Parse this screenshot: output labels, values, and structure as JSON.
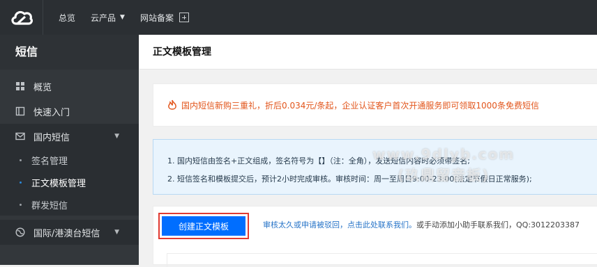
{
  "topbar": {
    "logo_icon": "cloud-logo-icon",
    "nav": [
      {
        "label": "总览"
      },
      {
        "label": "云产品"
      },
      {
        "label": "网站备案"
      }
    ]
  },
  "sidebar": {
    "title": "短信",
    "items": [
      {
        "label": "概览",
        "icon": "grid-icon"
      },
      {
        "label": "快速入门",
        "icon": "book-icon"
      },
      {
        "label": "国内短信",
        "icon": "mail-icon"
      }
    ],
    "domestic_subitems": [
      {
        "label": "签名管理"
      },
      {
        "label": "正文模板管理"
      },
      {
        "label": "群发短信"
      }
    ],
    "intl": {
      "label": "国际/港澳台短信",
      "icon": "globe-icon"
    }
  },
  "main": {
    "title": "正文模板管理",
    "promo": "国内短信新购三重礼，折后0.034元/条起，企业认证客户首次开通服务即可领取1000条免费短信",
    "notice": [
      "1. 国内短信由签名+正文组成，签名符号为【】（注：全角），发送短信内容时必须带签名;",
      "2. 短信签名和模板提交后，预计2小时完成审核。审核时间：周一至周日9:00-23:00(法定节假日正常服务);"
    ],
    "create_label": "创建正文模板",
    "hint_link": "审核太久或申请被驳回，点击此处联系我们。",
    "hint_text": "或手动添加小助手联系我们，QQ:3012203387"
  },
  "watermark": {
    "line1": "www.9dlyb.com",
    "line2": "(玖鼎留音板)"
  },
  "colors": {
    "topbar": "#2b2f33",
    "sidebar": "#33373b",
    "accent": "#006eff",
    "promo": "#e2551b",
    "highlight_border": "#e13a32"
  }
}
